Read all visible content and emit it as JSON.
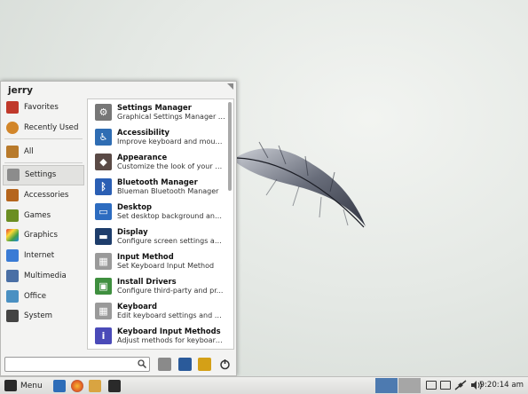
{
  "menu": {
    "username": "jerry",
    "categories": [
      {
        "label": "Favorites",
        "icon": "favorites-icon",
        "color": "#c0392b"
      },
      {
        "label": "Recently Used",
        "icon": "clock-icon",
        "color": "#d2862a"
      },
      {
        "label": "All",
        "icon": "all-apps-icon",
        "color": "#b87a2b"
      },
      {
        "label": "Settings",
        "icon": "settings-icon",
        "color": "#8c8c8c"
      },
      {
        "label": "Accessories",
        "icon": "accessories-icon",
        "color": "#b5651d"
      },
      {
        "label": "Games",
        "icon": "games-icon",
        "color": "#6b8e23"
      },
      {
        "label": "Graphics",
        "icon": "graphics-icon",
        "color": "#e64a19"
      },
      {
        "label": "Internet",
        "icon": "internet-icon",
        "color": "#3a7bd5"
      },
      {
        "label": "Multimedia",
        "icon": "multimedia-icon",
        "color": "#4a6fa5"
      },
      {
        "label": "Office",
        "icon": "office-icon",
        "color": "#4a90c2"
      },
      {
        "label": "System",
        "icon": "system-icon",
        "color": "#444444"
      }
    ],
    "active_category": "Settings",
    "apps": [
      {
        "name": "Settings Manager",
        "desc": "Graphical Settings Manager f...",
        "icon": "settings-manager-icon",
        "color": "#777777"
      },
      {
        "name": "Accessibility",
        "desc": "Improve keyboard and mous...",
        "icon": "accessibility-icon",
        "color": "#2f6db3"
      },
      {
        "name": "Appearance",
        "desc": "Customize the look of your d...",
        "icon": "appearance-icon",
        "color": "#5a4a46"
      },
      {
        "name": "Bluetooth Manager",
        "desc": "Blueman Bluetooth Manager",
        "icon": "bluetooth-icon",
        "color": "#2b5fb4"
      },
      {
        "name": "Desktop",
        "desc": "Set desktop background and ...",
        "icon": "desktop-icon",
        "color": "#2d6cc0"
      },
      {
        "name": "Display",
        "desc": "Configure screen settings an...",
        "icon": "display-icon",
        "color": "#1e3d6b"
      },
      {
        "name": "Input Method",
        "desc": "Set Keyboard Input Method",
        "icon": "keyboard-icon",
        "color": "#9a9a9a"
      },
      {
        "name": "Install Drivers",
        "desc": "Configure third-party and pr...",
        "icon": "driver-icon",
        "color": "#3f8f3f"
      },
      {
        "name": "Keyboard",
        "desc": "Edit keyboard settings and a...",
        "icon": "keyboard-icon",
        "color": "#9a9a9a"
      },
      {
        "name": "Keyboard Input Methods",
        "desc": "Adjust methods for keyboard...",
        "icon": "input-methods-icon",
        "color": "#4a4ab8"
      }
    ],
    "search": {
      "value": "",
      "placeholder": ""
    }
  },
  "taskbar": {
    "menu_label": "Menu",
    "clock": "9:20:14 am"
  }
}
